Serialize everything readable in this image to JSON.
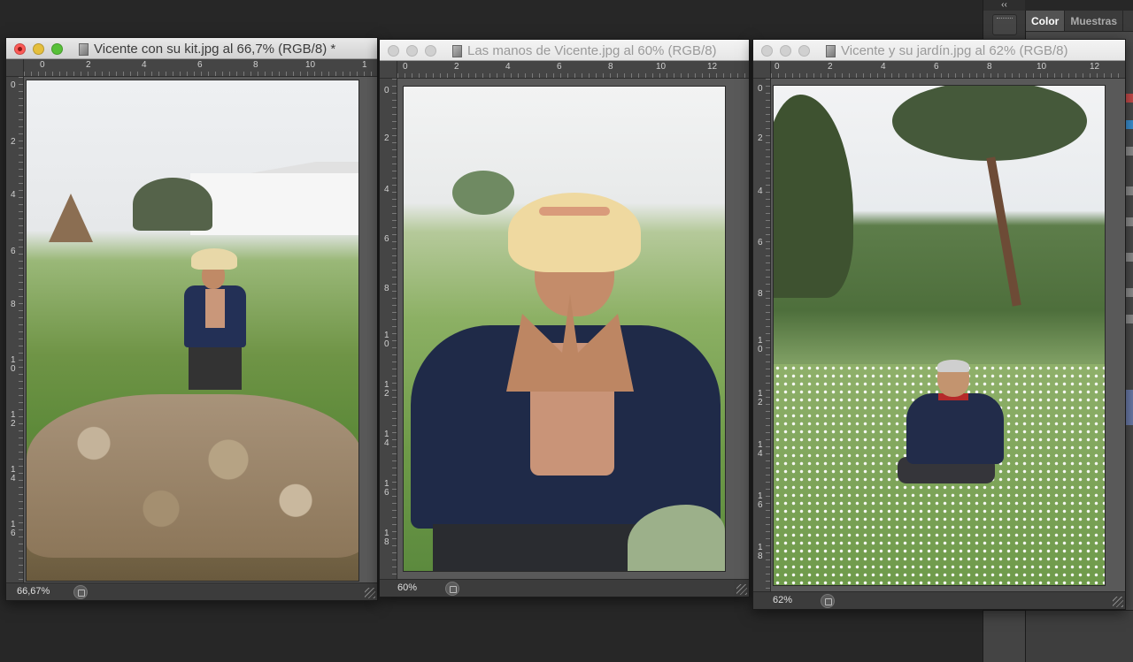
{
  "right_panel": {
    "collapse_glyph": "‹‹",
    "tabs": [
      {
        "label": "Color",
        "active": true
      },
      {
        "label": "Muestras",
        "active": false
      }
    ]
  },
  "windows": [
    {
      "title": "Vicente con su kit.jpg al 66,7% (RGB/8) *",
      "zoom": "66,67%",
      "active": true,
      "ruler_h": [
        "0",
        "2",
        "4",
        "6",
        "8",
        "10",
        "1"
      ],
      "ruler_v": [
        "0",
        "2",
        "4",
        "6",
        "8",
        "1\n0",
        "1\n2",
        "1\n4",
        "1\n6"
      ]
    },
    {
      "title": "Las manos de Vicente.jpg al 60% (RGB/8)",
      "zoom": "60%",
      "active": false,
      "ruler_h": [
        "0",
        "2",
        "4",
        "6",
        "8",
        "10",
        "12"
      ],
      "ruler_v": [
        "0",
        "2",
        "4",
        "6",
        "8",
        "1\n0",
        "1\n2",
        "1\n4",
        "1\n6",
        "1\n8"
      ]
    },
    {
      "title": "Vicente y su jardín.jpg al 62% (RGB/8)",
      "zoom": "62%",
      "active": false,
      "ruler_h": [
        "0",
        "2",
        "4",
        "6",
        "8",
        "10",
        "12"
      ],
      "ruler_v": [
        "0",
        "2",
        "4",
        "6",
        "8",
        "1\n0",
        "1\n2",
        "1\n4",
        "1\n6",
        "1\n8"
      ]
    }
  ],
  "colors": {
    "close": "#fc5b57",
    "minimize": "#e5bf3c",
    "maximize": "#57c038",
    "workspace": "#272727"
  }
}
